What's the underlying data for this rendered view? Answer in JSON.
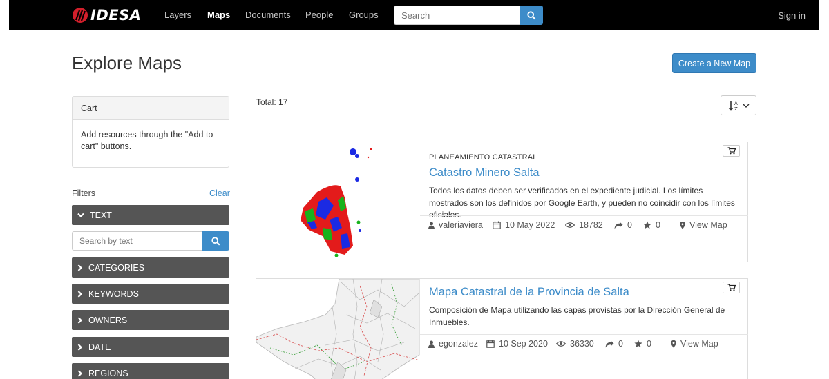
{
  "navbar": {
    "brand": "IDESA",
    "links": [
      {
        "label": "Layers",
        "active": false
      },
      {
        "label": "Maps",
        "active": true
      },
      {
        "label": "Documents",
        "active": false
      },
      {
        "label": "People",
        "active": false
      },
      {
        "label": "Groups",
        "active": false
      }
    ],
    "search_placeholder": "Search",
    "sign_in": "Sign in"
  },
  "header": {
    "title": "Explore Maps",
    "create_button": "Create a New Map"
  },
  "sidebar": {
    "cart_title": "Cart",
    "cart_body": "Add resources through the \"Add to cart\" buttons.",
    "filters_label": "Filters",
    "clear_label": "Clear",
    "text_facet": "TEXT",
    "text_search_placeholder": "Search by text",
    "facets": [
      "CATEGORIES",
      "KEYWORDS",
      "OWNERS",
      "DATE",
      "REGIONS"
    ]
  },
  "results": {
    "total": "Total: 17",
    "items": [
      {
        "category": "PLANEAMIENTO CATASTRAL",
        "title": "Catastro Minero Salta",
        "description": "Todos los datos deben ser verificados en el expediente judicial. Los límites mostrados son los definidos por Google Earth, y pueden no coincidir con los límites oficiales.",
        "owner": "valeriaviera",
        "date": "10 May 2022",
        "views": "18782",
        "shares": "0",
        "stars": "0",
        "view_label": "View Map"
      },
      {
        "category": "",
        "title": "Mapa Catastral de la Provincia de Salta",
        "description": "Composición de Mapa utilizando las capas provistas por la Dirección General de Inmuebles.",
        "owner": "egonzalez",
        "date": "10 Sep 2020",
        "views": "36330",
        "shares": "0",
        "stars": "0",
        "view_label": "View Map"
      }
    ]
  },
  "colors": {
    "accent": "#3d8cc9",
    "navbar": "#000000",
    "facet": "#555555"
  },
  "icons": [
    "logo-icon",
    "search-icon",
    "sort-alpha-icon",
    "chevron-down-icon",
    "chevron-right-icon",
    "cart-icon",
    "user-icon",
    "calendar-icon",
    "eye-icon",
    "share-icon",
    "star-icon",
    "map-marker-icon"
  ]
}
